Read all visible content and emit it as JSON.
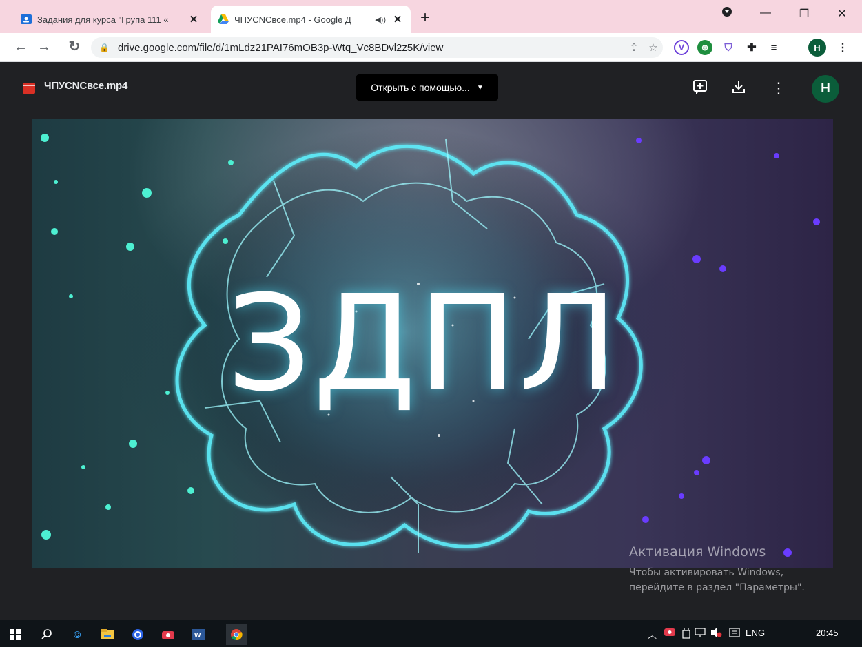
{
  "browser": {
    "tabs": [
      {
        "title": "Задания для курса \"Група 111 «",
        "favicon": "google-classroom-icon"
      },
      {
        "title": "ЧПУСNCвсе.mp4 - Google Д",
        "favicon": "google-drive-icon",
        "audio": "speaker-icon"
      }
    ],
    "new_tab": "+",
    "window_controls": {
      "minimize": "—",
      "restore": "❐",
      "close": "✕"
    },
    "url": "drive.google.com/file/d/1mLdz21PAI76mOB3p-Wtq_Vc8BDvl2z5K/view",
    "profile_initial": "H"
  },
  "drive": {
    "file_name": "ЧПУСNCвсе.mp4",
    "open_with": "Открыть с помощью...",
    "profile_initial": "H"
  },
  "video": {
    "text": "ЗДПЛ"
  },
  "watermark": {
    "title": "Активация Windows",
    "line1": "Чтобы активировать Windows,",
    "line2": "перейдите в раздел \"Параметры\"."
  },
  "taskbar": {
    "language": "ENG",
    "time": "20:45"
  },
  "colors": {
    "tab_strip": "#f7d6e0",
    "drive_bg": "#202124",
    "avatar": "#0b5d3a",
    "taskbar": "#0f1418"
  }
}
